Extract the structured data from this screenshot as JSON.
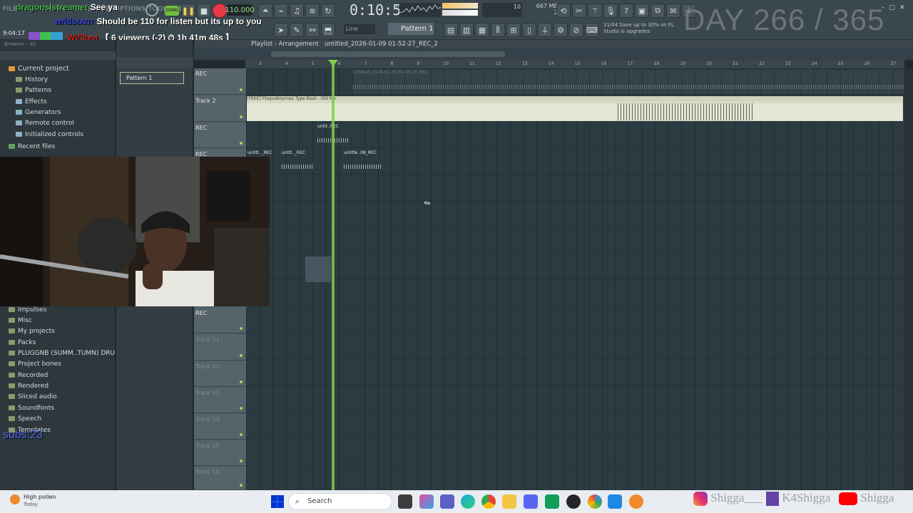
{
  "chat": {
    "line1_user": "dragonslstreamer",
    "line1_msg": "See ya",
    "line2_user": "wrldstxrrr",
    "line2_msg": "Should be 110 for listen but its up to you",
    "line3_user": "W23bot",
    "line3_msg": "【 6 viewers (-2) ⏱ 1h 41m 48s 】",
    "clock": "9:04:17"
  },
  "menu": "FILE EDIT ADD PATTERNS VIEW OPTIONS TOOLS HELP",
  "toolbar": {
    "tempo": "110.000",
    "time": "0:10:55",
    "time_unit": "M:S:CS",
    "memory": "667 MB",
    "cpu": "10",
    "voices": "2",
    "snap": "Line",
    "pattern": "Pattern 1",
    "news_date": "11/04",
    "news_line1": "Save up to 30% on FL",
    "news_line2": "Studio & upgrades",
    "day_counter": "DAY 266 / 365"
  },
  "browser": {
    "header": "Browser - All",
    "items": [
      {
        "label": "Current project"
      },
      {
        "label": "History"
      },
      {
        "label": "Patterns"
      },
      {
        "label": "Effects"
      },
      {
        "label": "Generators"
      },
      {
        "label": "Remote control"
      },
      {
        "label": "Initialized controls"
      },
      {
        "label": "Recent files"
      }
    ],
    "items_lower": [
      {
        "label": "Impulses"
      },
      {
        "label": "Misc"
      },
      {
        "label": "My projects"
      },
      {
        "label": "Packs"
      },
      {
        "label": "PLUGGNB (SUMM..TUMN) DRUMKIT"
      },
      {
        "label": "Project bones"
      },
      {
        "label": "Recorded"
      },
      {
        "label": "Rendered"
      },
      {
        "label": "Sliced audio"
      },
      {
        "label": "Soundfonts"
      },
      {
        "label": "Speech"
      },
      {
        "label": "Templates"
      }
    ],
    "subs": "subs:23"
  },
  "patterns": {
    "item": "Pattern 1"
  },
  "playlist": {
    "title": "Playlist - Arrangement",
    "arrangement": "untitled_2026-01-09 01-52-27_REC_2",
    "ruler": [
      "3",
      "4",
      "5",
      "6",
      "7",
      "8",
      "9",
      "10",
      "11",
      "12",
      "13",
      "14",
      "15",
      "16",
      "17",
      "18",
      "19",
      "20",
      "21",
      "22",
      "23",
      "24",
      "25",
      "26",
      "27"
    ],
    "tracks": [
      {
        "label": "REC"
      },
      {
        "label": "Track 2"
      },
      {
        "label": "REC"
      },
      {
        "label": "REC"
      },
      {
        "label": "REC"
      },
      {
        "label": "Track 11"
      },
      {
        "label": "Track 12"
      },
      {
        "label": "Track 13"
      },
      {
        "label": "Track 14"
      },
      {
        "label": "Track 15"
      },
      {
        "label": "Track 16"
      }
    ],
    "clips": {
      "c1": "untitled_2026-01-09 01-45-35_REC",
      "c2": "[FREE] Plaqueboymax Type Beat - Old Me",
      "c3": "untit..REC",
      "c4": "untitl.._REC",
      "c5": "untit.._REC",
      "c6": "untitle..08_REC"
    }
  },
  "taskbar": {
    "weather_title": "High pollen",
    "weather_sub": "Today",
    "search": "Search",
    "instagram": "Shigga___",
    "twitch": "K4Shigga",
    "youtube": "Shigga"
  },
  "colors": {
    "accent": "#7fcf43",
    "grid": "#2c3b42",
    "record": "#e8394a"
  }
}
